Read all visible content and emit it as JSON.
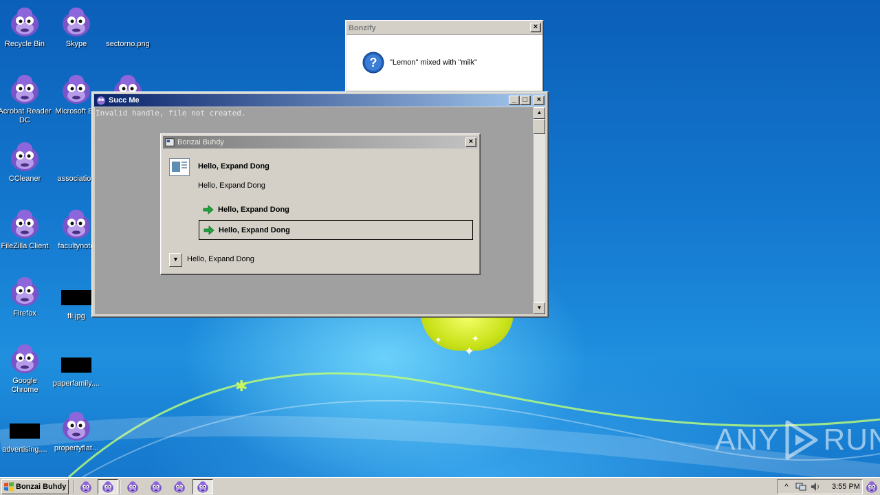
{
  "desktop": {
    "icons": [
      {
        "label": "Recycle Bin",
        "kind": "bonzi"
      },
      {
        "label": "Skype",
        "kind": "bonzi"
      },
      {
        "label": "sectorno.png",
        "kind": "none"
      },
      {
        "label": "Acrobat Reader DC",
        "kind": "bonzi"
      },
      {
        "label": "Microsoft Ed",
        "kind": "bonzi"
      },
      {
        "label": "CCleaner",
        "kind": "bonzi"
      },
      {
        "label": "association",
        "kind": "none"
      },
      {
        "label": "FileZilla Client",
        "kind": "bonzi"
      },
      {
        "label": "facultynote",
        "kind": "bonzi"
      },
      {
        "label": "Firefox",
        "kind": "bonzi"
      },
      {
        "label": "fli.jpg",
        "kind": "black"
      },
      {
        "label": "Google Chrome",
        "kind": "bonzi"
      },
      {
        "label": "paperfamily....",
        "kind": "black"
      },
      {
        "label": "advertising....",
        "kind": "black"
      },
      {
        "label": "propertyflat...",
        "kind": "bonzi"
      }
    ],
    "watermark": {
      "left": "ANY",
      "right": "RUN"
    }
  },
  "bonzify_window": {
    "title": "Bonzify",
    "close": "×",
    "icon": "question-icon",
    "message": "\"Lemon\" mixed with \"milk\""
  },
  "succ_window": {
    "title": "Succ Me",
    "console_text": "Invalid handle, file not created.",
    "buttons": {
      "minimize": "_",
      "maximize": "□",
      "close": "×"
    },
    "scroll_up": "▲",
    "scroll_down": "▼"
  },
  "buhdy_dialog": {
    "title": "Bonzai Buhdy",
    "close": "×",
    "heading": "Hello, Expand Dong",
    "subtext": "Hello, Expand Dong",
    "options": [
      {
        "label": "Hello, Expand Dong"
      },
      {
        "label": "Hello, Expand Dong"
      }
    ],
    "expander_label": "Hello, Expand Dong",
    "expander_glyph": "▼"
  },
  "taskbar": {
    "start_label": "Bonzai Buhdy",
    "tray": {
      "chevron": "^",
      "time": "3:55 PM"
    }
  }
}
